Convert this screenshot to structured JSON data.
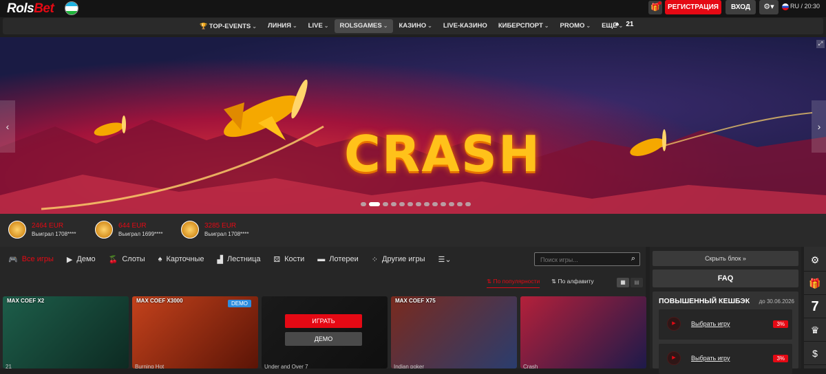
{
  "header": {
    "logo_prefix": "Rols",
    "logo_suffix": "Bet",
    "register_label": "РЕГИСТРАЦИЯ",
    "login_label": "ВХОД",
    "lang_time": "RU / 20:30",
    "gift_icon": "gift-icon",
    "settings_icon": "gear-icon"
  },
  "nav": {
    "items": [
      {
        "label": "TOP-EVENTS",
        "icon": "trophy-icon"
      },
      {
        "label": "ЛИНИЯ"
      },
      {
        "label": "LIVE"
      },
      {
        "label": "ROLSGAMES"
      },
      {
        "label": "КАЗИНО"
      },
      {
        "label": "LIVE-КАЗИНО"
      },
      {
        "label": "КИБЕРСПОРТ"
      },
      {
        "label": "PROMO"
      },
      {
        "label": "ЕЩЁ"
      }
    ],
    "counter": "21"
  },
  "banner": {
    "title": "CRASH",
    "slides_total": 13,
    "active_slide": 2
  },
  "wins": [
    {
      "amount": "2464 EUR",
      "who": "Выиграл 1708****"
    },
    {
      "amount": "644 EUR",
      "who": "Выиграл 1699****"
    },
    {
      "amount": "3285 EUR",
      "who": "Выиграл 1708****"
    }
  ],
  "categories": [
    {
      "label": "Все игры",
      "icon": "gamepad-icon"
    },
    {
      "label": "Демо",
      "icon": "play-icon"
    },
    {
      "label": "Слоты",
      "icon": "cherry-icon"
    },
    {
      "label": "Карточные",
      "icon": "spade-icon"
    },
    {
      "label": "Лестница",
      "icon": "ladder-icon"
    },
    {
      "label": "Кости",
      "icon": "dice-icon"
    },
    {
      "label": "Лотереи",
      "icon": "ticket-icon"
    },
    {
      "label": "Другие игры",
      "icon": "dots-icon"
    }
  ],
  "search": {
    "placeholder": "Поиск игры..."
  },
  "sort": {
    "popular": "По популярности",
    "alpha": "По алфавиту"
  },
  "games": [
    {
      "coef": "MAX COEF X2",
      "name": "21",
      "colors": [
        "#1d5e4a",
        "#0d2a22"
      ]
    },
    {
      "coef": "MAX COEF X3000",
      "name": "Burning Hot",
      "demo": "DEMO",
      "colors": [
        "#c4421c",
        "#5b1406"
      ]
    },
    {
      "coef": "",
      "name": "Under and Over 7",
      "play": "ИГРАТЬ",
      "demo_btn": "ДЕМО",
      "colors": [
        "#1a1a1a",
        "#0f0f0f"
      ]
    },
    {
      "coef": "MAX COEF X75",
      "name": "Indian poker",
      "colors": [
        "#7a2a1e",
        "#2a3d6e"
      ]
    },
    {
      "coef": "",
      "name": "Crash",
      "colors": [
        "#b4203a",
        "#1d1a4a"
      ]
    }
  ],
  "aside": {
    "hide_label": "Скрыть блок »",
    "faq_label": "FAQ",
    "cashback_title": "ПОВЫШЕННЫЙ КЕШБЭК",
    "cashback_date": "до 30.06.2026",
    "rows": [
      {
        "label": "Выбрать игру",
        "pct": "3%"
      },
      {
        "label": "Выбрать игру",
        "pct": "3%"
      }
    ]
  },
  "rail": {
    "items": [
      "settings-icon",
      "gift-icon",
      "seven-icon",
      "trophy-icon",
      "dollar-icon"
    ]
  },
  "colors": {
    "accent": "#e50914",
    "panel": "#262626",
    "button": "#3a3a3a"
  }
}
